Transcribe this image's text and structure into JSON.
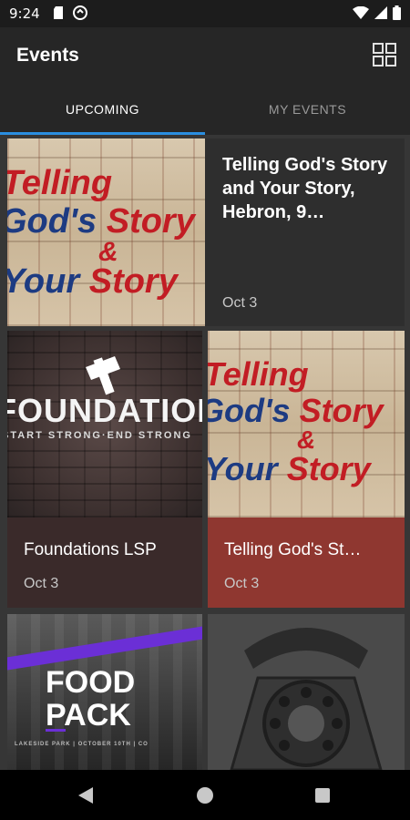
{
  "status": {
    "time": "9:24"
  },
  "appbar": {
    "title": "Events"
  },
  "tabs": [
    {
      "label": "UPCOMING",
      "active": true
    },
    {
      "label": "MY EVENTS",
      "active": false
    }
  ],
  "events": [
    {
      "title": "Telling God's Story and Your Story, Hebron, 9…",
      "date": "Oct 3",
      "art": {
        "l1": "Telling",
        "l2a": "God's",
        "l2b": "Story",
        "l3": "&",
        "l4a": "Your",
        "l4b": "Story"
      }
    },
    {
      "title": "Foundations LSP",
      "date": "Oct 3",
      "art": {
        "word": "FOUNDATIONS",
        "tagline": "START STRONG·END STRONG"
      }
    },
    {
      "title": "Telling God's St…",
      "date": "Oct 3",
      "art": {
        "l1": "Telling",
        "l2a": "God's",
        "l2b": "Story",
        "l3": "&",
        "l4a": "Your",
        "l4b": "Story"
      }
    },
    {
      "art": {
        "l1": "FOOD",
        "l2": "PACK",
        "footer": "LAKESIDE PARK | OCTOBER 10TH | CO"
      }
    },
    {
      "art": {}
    }
  ],
  "colors": {
    "accent": "#2a8ee0",
    "foundation_card": "#3a2a2a",
    "telling_card": "#8f3730"
  }
}
